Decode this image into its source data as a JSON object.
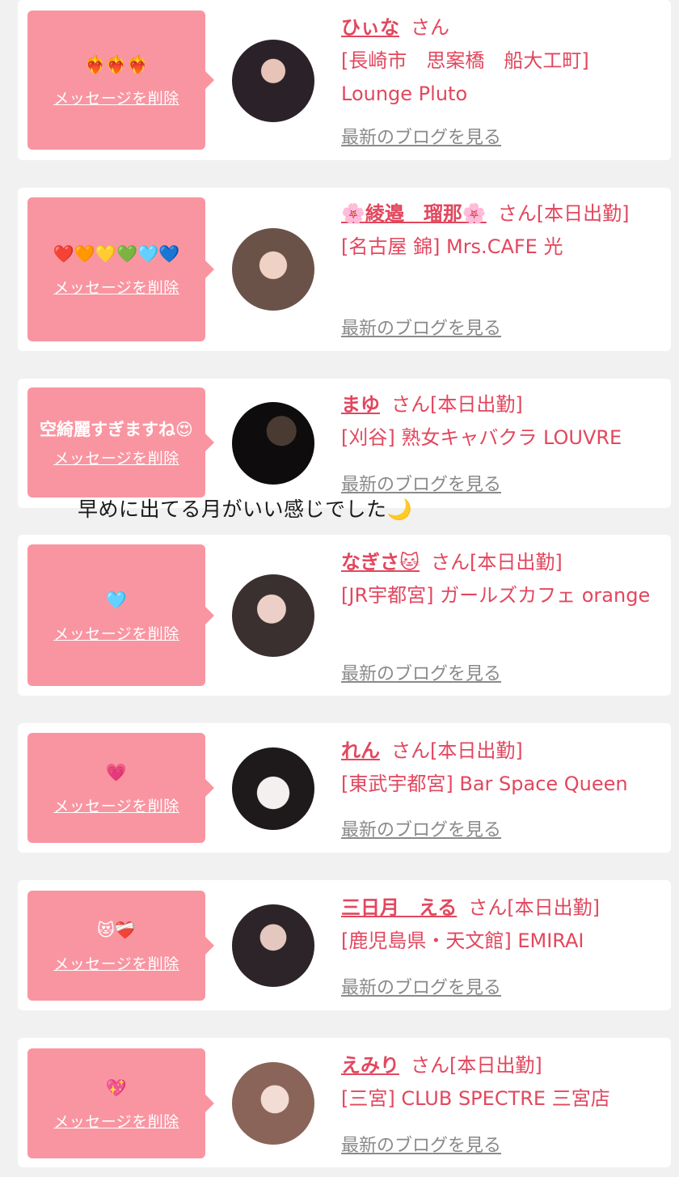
{
  "delete_label": "メッセージを削除",
  "blog_label": "最新のブログを見る",
  "overlay_text": "早めに出てる月がいい感じでした🌙",
  "colors": {
    "accent": "#e2475e",
    "bubble": "#f995a1",
    "card": "#ffffff",
    "background": "#f1f1f1"
  },
  "items": [
    {
      "message": "❤️‍🔥❤️‍🔥❤️‍🔥",
      "name": "ひぃな",
      "honorific": "さん",
      "status": "",
      "shop": "[長崎市　思案橋　船大工町] Lounge Pluto"
    },
    {
      "message": "❤️🧡💛💚🩵💙",
      "name": "🌸綾邉　瑠那🌸",
      "honorific": "さん",
      "status": "[本日出勤]",
      "shop": "[名古屋 錦] Mrs.CAFE 光"
    },
    {
      "message": "空綺麗すぎますね😍",
      "name": "まゆ",
      "honorific": "さん",
      "status": "[本日出勤]",
      "shop": "[刈谷] 熟女キャバクラ LOUVRE"
    },
    {
      "message": "🩵",
      "name": "なぎさ🐱",
      "honorific": "さん",
      "status": "[本日出勤]",
      "shop": "[JR宇都宮] ガールズカフェ orange"
    },
    {
      "message": "💗",
      "name": "れん",
      "honorific": "さん",
      "status": "[本日出勤]",
      "shop": "[東武宇都宮] Bar Space Queen"
    },
    {
      "message": "😻❤️‍🩹",
      "name": "三日月　える",
      "honorific": "さん",
      "status": "[本日出勤]",
      "shop": "[鹿児島県・天文館] EMIRAI"
    },
    {
      "message": "💖",
      "name": "えみり",
      "honorific": "さん",
      "status": "[本日出勤]",
      "shop": "[三宮] CLUB SPECTRE 三宮店"
    }
  ]
}
